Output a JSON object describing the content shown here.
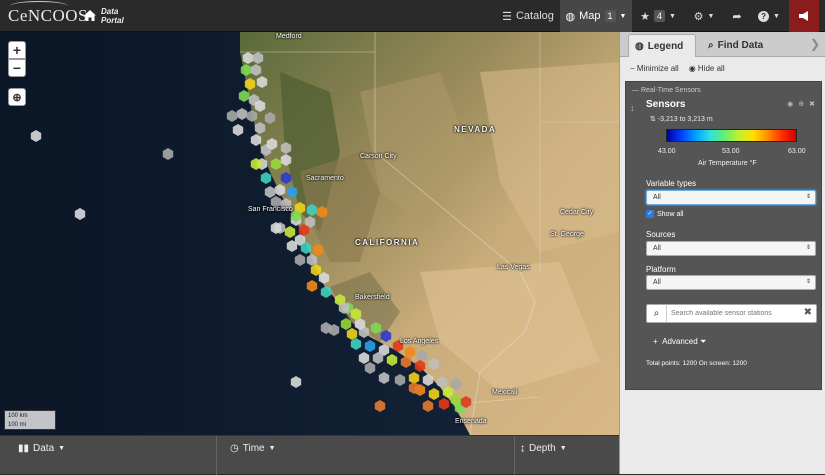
{
  "header": {
    "logo_text": "CeNCOOS",
    "portal_label": "Data Portal",
    "nav": {
      "catalog": "Catalog",
      "map": "Map",
      "map_badge": "1",
      "star_badge": "4"
    }
  },
  "map": {
    "zoom_in": "+",
    "zoom_out": "−",
    "labels": {
      "medford": "Medford",
      "nevada": "NEVADA",
      "carson_city": "Carson City",
      "sacramento": "Sacramento",
      "san_francisco": "San Francisco",
      "california": "CALIFORNIA",
      "cedar_city": "Cedar City",
      "st_george": "St. George",
      "las_vegas": "Las Vegas",
      "bakersfield": "Bakersfield",
      "los_angeles": "Los Angeles",
      "mexicali": "Mexicali",
      "ensenada": "Ensenada"
    },
    "scale": {
      "km": "100 km",
      "mi": "100 mi"
    }
  },
  "bottombar": {
    "data": "Data",
    "time": "Time",
    "depth": "Depth"
  },
  "panel": {
    "tabs": {
      "legend": "Legend",
      "find_data": "Find Data"
    },
    "minimize_all": "Minimize all",
    "hide_all": "Hide all",
    "group_title": "Real-Time Sensors",
    "layer_title": "Sensors",
    "depth_range": "-3,213 to 3,213 m",
    "colorbar": {
      "min": "43.00",
      "mid": "53.00",
      "max": "63.00",
      "label": "Air Temperature °F"
    },
    "variable_types_label": "Variable types",
    "variable_types_value": "All",
    "show_all": "Show all",
    "sources_label": "Sources",
    "sources_value": "All",
    "platform_label": "Platform",
    "platform_value": "All",
    "search_placeholder": "Search available sensor stations",
    "advanced": "Advanced",
    "totals": "Total points: 1200 On screen: 1200"
  },
  "colors": {
    "topbar": "#2a2a2a",
    "announce": "#8b1c1c",
    "panel_box": "#555555"
  }
}
